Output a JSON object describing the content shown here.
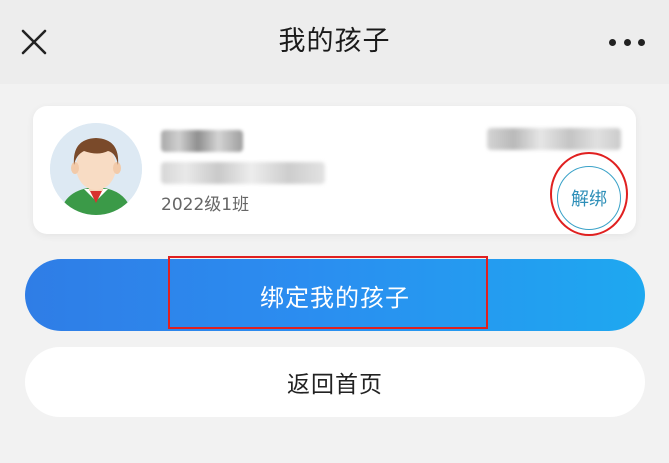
{
  "header": {
    "title": "我的孩子",
    "close_icon": "close-icon",
    "more_icon": "more-icon"
  },
  "child_card": {
    "class_name": "2022级1班",
    "unbind_label": "解绑",
    "avatar_icon": "child-avatar-icon"
  },
  "actions": {
    "bind_label": "绑定我的孩子",
    "home_label": "返回首页"
  },
  "colors": {
    "accent_blue": "#2f7de6",
    "accent_blue_end": "#1ea8f0",
    "unbind_border": "#3aa2c8",
    "highlight_red": "#e02020",
    "background": "#f2f2f2"
  }
}
